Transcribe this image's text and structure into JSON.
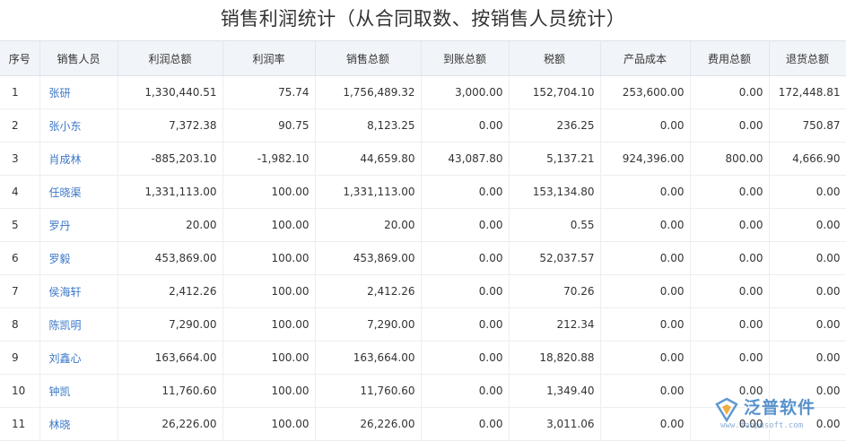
{
  "page": {
    "title": "销售利润统计（从合同取数、按销售人员统计）"
  },
  "table": {
    "columns": [
      "序号",
      "销售人员",
      "利润总额",
      "利润率",
      "销售总额",
      "到账总额",
      "税额",
      "产品成本",
      "费用总额",
      "退货总额"
    ],
    "rows": [
      [
        "1",
        "张研",
        "1,330,440.51",
        "75.74",
        "1,756,489.32",
        "3,000.00",
        "152,704.10",
        "253,600.00",
        "0.00",
        "172,448.81"
      ],
      [
        "2",
        "张小东",
        "7,372.38",
        "90.75",
        "8,123.25",
        "0.00",
        "236.25",
        "0.00",
        "0.00",
        "750.87"
      ],
      [
        "3",
        "肖成林",
        "-885,203.10",
        "-1,982.10",
        "44,659.80",
        "43,087.80",
        "5,137.21",
        "924,396.00",
        "800.00",
        "4,666.90"
      ],
      [
        "4",
        "任晓渠",
        "1,331,113.00",
        "100.00",
        "1,331,113.00",
        "0.00",
        "153,134.80",
        "0.00",
        "0.00",
        "0.00"
      ],
      [
        "5",
        "罗丹",
        "20.00",
        "100.00",
        "20.00",
        "0.00",
        "0.55",
        "0.00",
        "0.00",
        "0.00"
      ],
      [
        "6",
        "罗毅",
        "453,869.00",
        "100.00",
        "453,869.00",
        "0.00",
        "52,037.57",
        "0.00",
        "0.00",
        "0.00"
      ],
      [
        "7",
        "侯海轩",
        "2,412.26",
        "100.00",
        "2,412.26",
        "0.00",
        "70.26",
        "0.00",
        "0.00",
        "0.00"
      ],
      [
        "8",
        "陈凯明",
        "7,290.00",
        "100.00",
        "7,290.00",
        "0.00",
        "212.34",
        "0.00",
        "0.00",
        "0.00"
      ],
      [
        "9",
        "刘鑫心",
        "163,664.00",
        "100.00",
        "163,664.00",
        "0.00",
        "18,820.88",
        "0.00",
        "0.00",
        "0.00"
      ],
      [
        "10",
        "钟凯",
        "11,760.60",
        "100.00",
        "11,760.60",
        "0.00",
        "1,349.40",
        "0.00",
        "0.00",
        "0.00"
      ],
      [
        "11",
        "林晓",
        "26,226.00",
        "100.00",
        "26,226.00",
        "0.00",
        "3,011.06",
        "0.00",
        "0.00",
        "0.00"
      ]
    ]
  },
  "watermark": {
    "brand": "泛普软件",
    "url": "www.fanpusoft.com",
    "logo_icon": "fanpu-logo-icon",
    "color": "#3a7fc2"
  },
  "colors": {
    "header_bg": "#f1f4f8",
    "link": "#3c78c8"
  }
}
